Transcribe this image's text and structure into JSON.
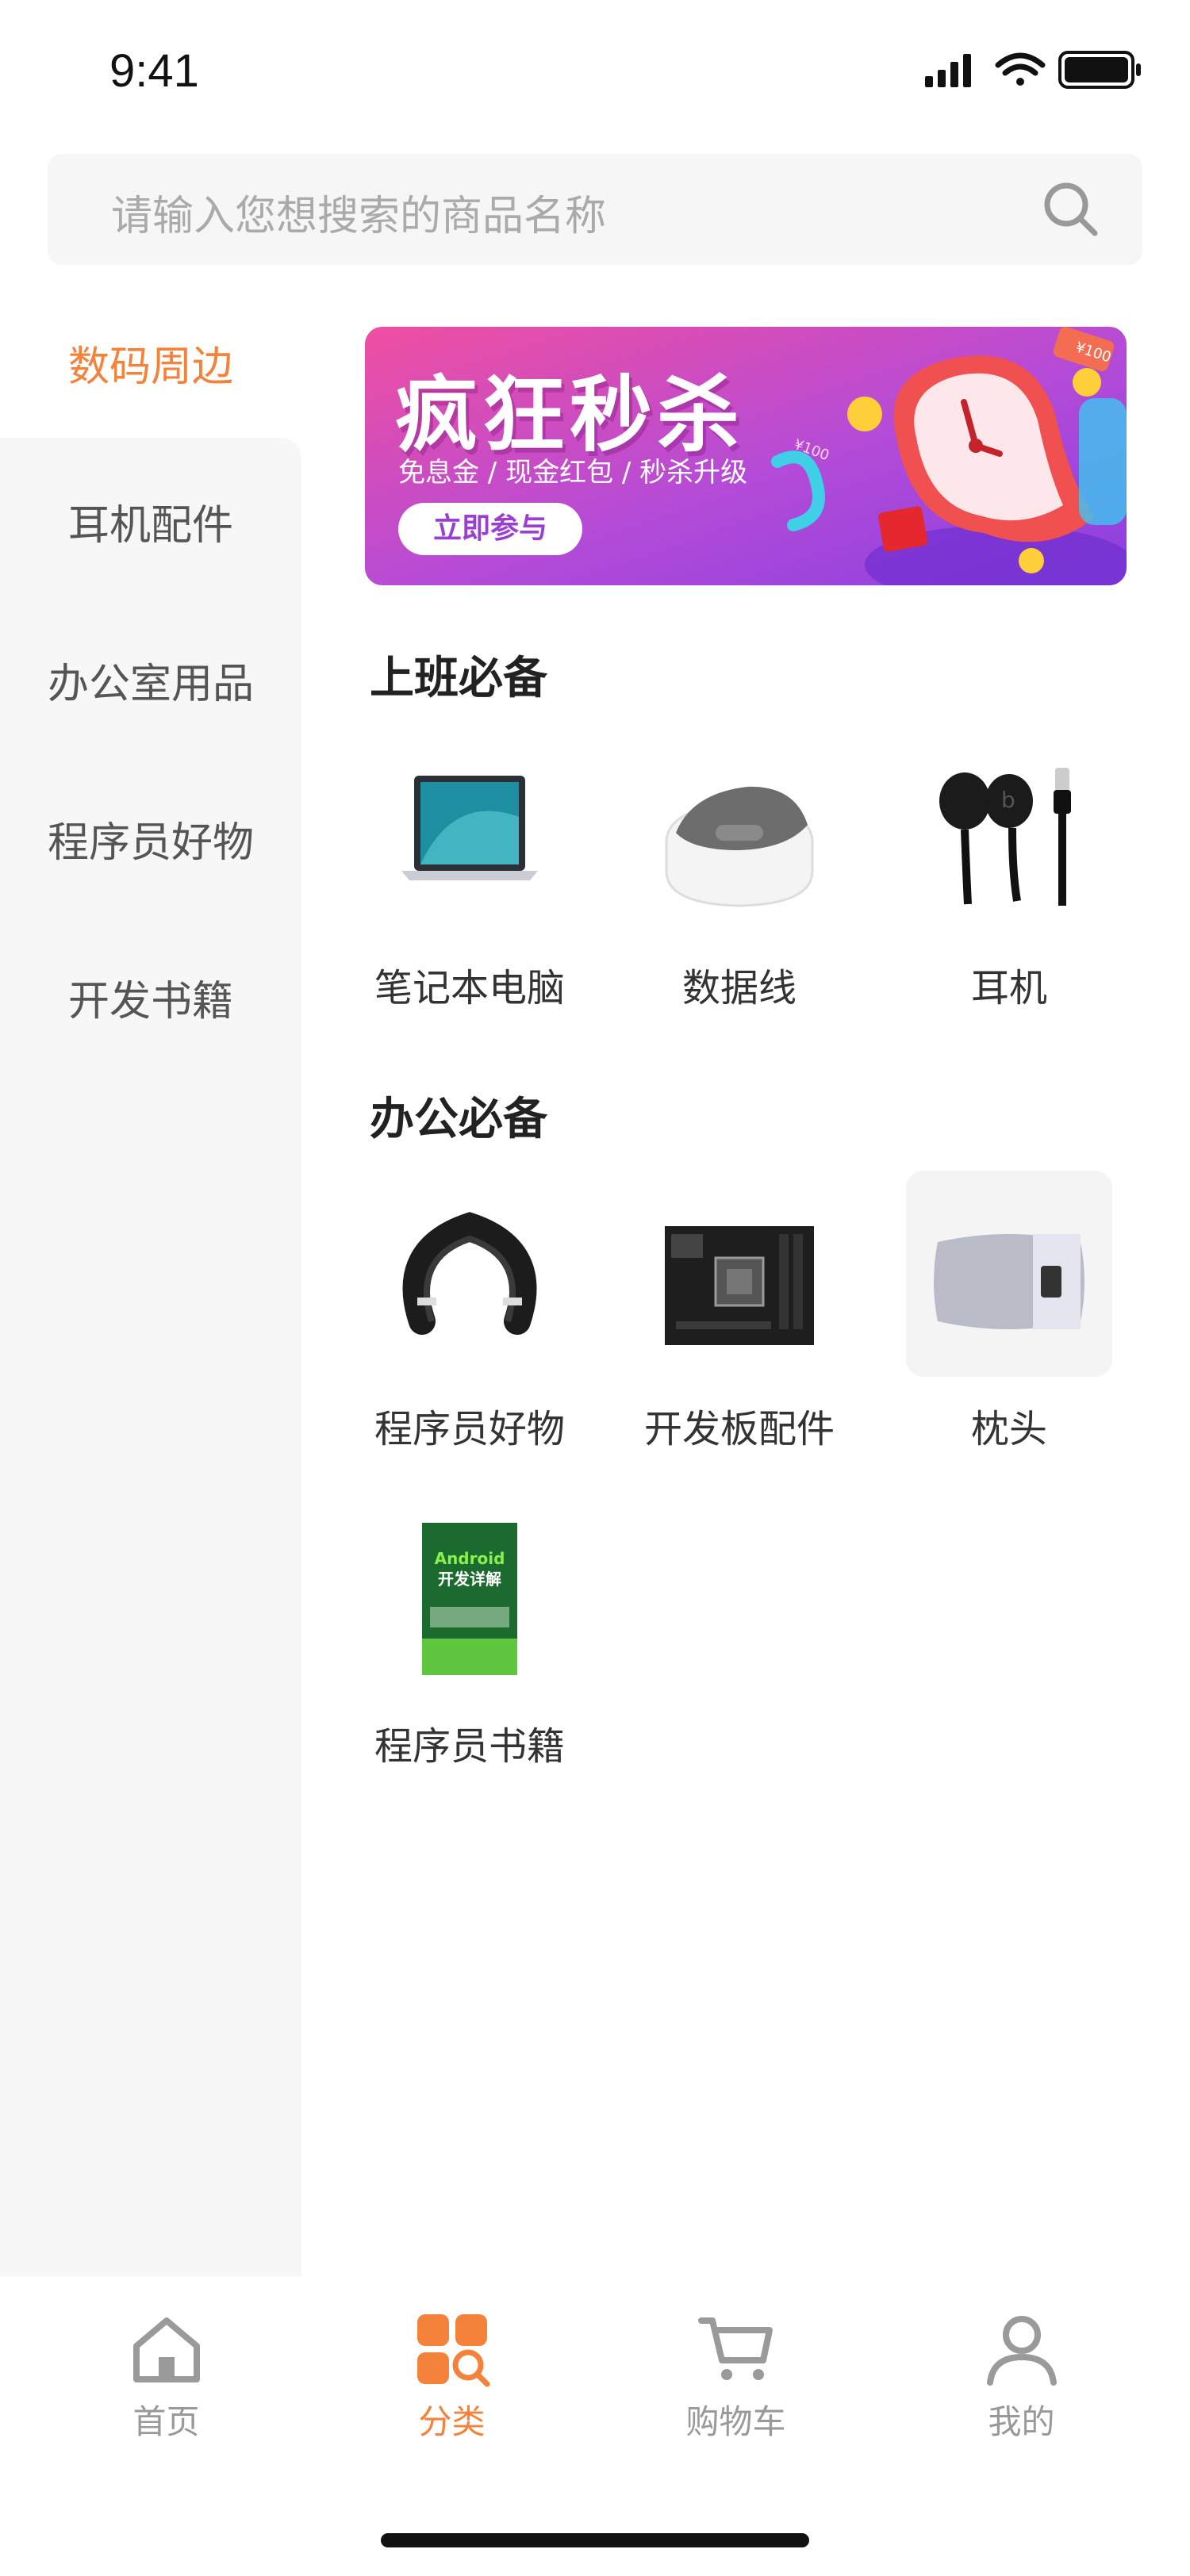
{
  "status": {
    "time": "9:41"
  },
  "search": {
    "placeholder": "请输入您想搜索的商品名称"
  },
  "sidebar": {
    "items": [
      {
        "label": "数码周边",
        "active": true
      },
      {
        "label": "耳机配件",
        "active": false
      },
      {
        "label": "办公室用品",
        "active": false
      },
      {
        "label": "程序员好物",
        "active": false
      },
      {
        "label": "开发书籍",
        "active": false
      }
    ]
  },
  "banner": {
    "title": "疯狂秒杀",
    "subtitle": "免息金 / 现金红包 / 秒杀升级",
    "button": "立即参与",
    "tag1": "¥100",
    "tag2": "¥100"
  },
  "sections": [
    {
      "title": "上班必备",
      "products": [
        {
          "label": "笔记本电脑",
          "icon": "laptop-icon"
        },
        {
          "label": "数据线",
          "icon": "cable-case-icon"
        },
        {
          "label": "耳机",
          "icon": "earphones-icon"
        }
      ]
    },
    {
      "title": "办公必备",
      "products": [
        {
          "label": "程序员好物",
          "icon": "neck-massager-icon"
        },
        {
          "label": "开发板配件",
          "icon": "motherboard-icon"
        },
        {
          "label": "枕头",
          "icon": "pillow-icon"
        },
        {
          "label": "程序员书籍",
          "icon": "book-icon"
        }
      ]
    }
  ],
  "book": {
    "line1": "Android",
    "line2": "开发详解"
  },
  "tabbar": {
    "items": [
      {
        "label": "首页",
        "icon": "home-icon"
      },
      {
        "label": "分类",
        "icon": "category-icon",
        "active": true
      },
      {
        "label": "购物车",
        "icon": "cart-icon"
      },
      {
        "label": "我的",
        "icon": "user-icon"
      }
    ]
  },
  "colors": {
    "accent": "#f5823a",
    "sidebar_bg": "#f7f7f7",
    "search_bg": "#f6f6f6"
  }
}
